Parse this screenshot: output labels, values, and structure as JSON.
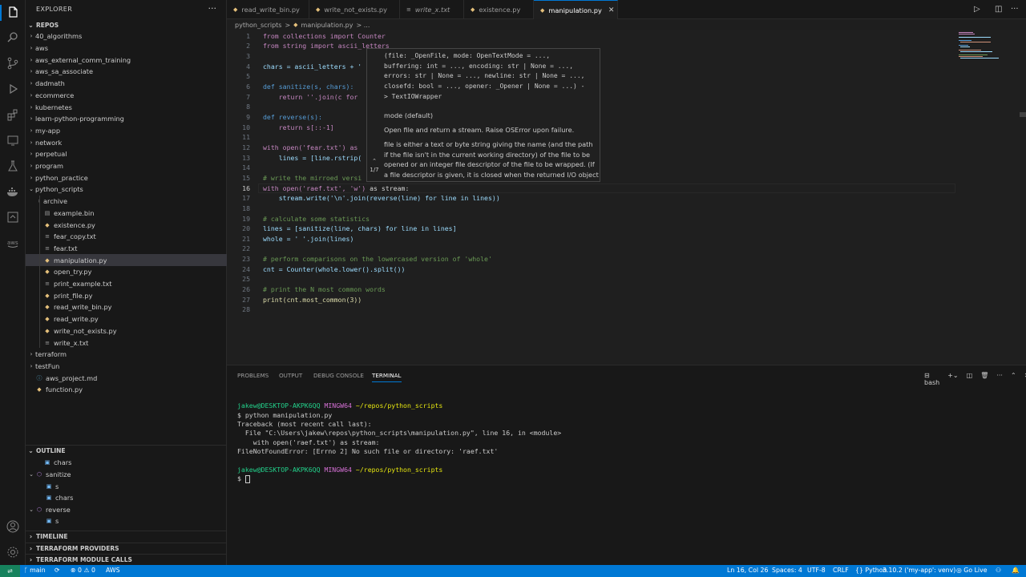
{
  "explorer": {
    "title": "EXPLORER",
    "more": "···",
    "repos_label": "REPOS",
    "folders": [
      "40_algorithms",
      "aws",
      "aws_external_comm_training",
      "aws_sa_associate",
      "dadmath",
      "ecommerce",
      "kubernetes",
      "learn-python-programming",
      "my-app",
      "network",
      "perpetual",
      "program",
      "python_practice",
      "python_scripts"
    ],
    "python_scripts_children": [
      "archive",
      "example.bin",
      "existence.py",
      "fear_copy.txt",
      "fear.txt",
      "manipulation.py",
      "open_try.py",
      "print_example.txt",
      "print_file.py",
      "read_write_bin.py",
      "read_write.py",
      "write_not_exists.py",
      "write_x.txt"
    ],
    "bottom_items": [
      "terraform",
      "testFun",
      "aws_project.md",
      "function.py"
    ]
  },
  "outline": {
    "label": "OUTLINE",
    "items": [
      "chars",
      "sanitize",
      "s",
      "chars",
      "reverse",
      "s"
    ]
  },
  "bottom_sections": [
    "TIMELINE",
    "TERRAFORM PROVIDERS",
    "TERRAFORM MODULE CALLS"
  ],
  "tabs": [
    "read_write_bin.py",
    "write_not_exists.py",
    "write_x.txt",
    "existence.py",
    "manipulation.py"
  ],
  "breadcrumb": {
    "folder": "python_scripts",
    "sep": ">",
    "file": "manipulation.py",
    "more": "> ..."
  },
  "code": {
    "l1": "from collections import Counter",
    "l2": "from string import ascii_letters",
    "l4": "chars = ascii_letters + '",
    "l6": "def sanitize(s, chars):",
    "l7": "    return ''.join(c for",
    "l9": "def reverse(s):",
    "l10": "    return s[::-1]",
    "l12": "with open('fear.txt') as",
    "l13": "    lines = [line.rstrip(",
    "l15": "# write the mirroed versi",
    "l16a": "with open('raef.txt', 'w')",
    "l16b": " as stream:",
    "l17": "    stream.write('\\n'.join(reverse(line) for line in lines))",
    "l19": "# calculate some statistics",
    "l20": "lines = [sanitize(line, chars) for line in lines]",
    "l21": "whole = ' '.join(lines)",
    "l23": "# perform comparisons on the lowercased version of 'whole'",
    "l24": "cnt = Counter(whole.lower().split())",
    "l26": "# print the N most common words",
    "l27": "print(cnt.most_common(3))"
  },
  "hover": {
    "sig1": "(file: _OpenFile, mode: OpenTextMode = ...,",
    "sig2": "buffering: int = ..., encoding: str | None = ...,",
    "sig3": "errors: str | None = ..., newline: str | None = ...,",
    "sig4": "closefd: bool = ..., opener: _Opener | None = ...) -",
    "sig5": "> TextIOWrapper",
    "param": "mode (default)",
    "summary": "Open file and return a stream. Raise OSError upon failure.",
    "detail": "file is either a text or byte string giving the name (and the path if the file isn't in the current working directory) of the file to be opened or an integer file descriptor of the file to be wrapped. (If a file descriptor is given, it is closed when the returned I/O object is closed, unless closefd is set to False.)",
    "pager": "1/7"
  },
  "panel": {
    "tabs": [
      "PROBLEMS",
      "OUTPUT",
      "DEBUG CONSOLE",
      "TERMINAL"
    ],
    "shell": "bash"
  },
  "terminal": {
    "user": "jakew@DESKTOP-AKPK6QQ",
    "env": "MINGW64",
    "path": "~/repos/python_scripts",
    "cmd": "$ python manipulation.py",
    "tb1": "Traceback (most recent call last):",
    "tb2": "  File \"C:\\Users\\jakew\\repos\\python_scripts\\manipulation.py\", line 16, in <module>",
    "tb3": "    with open('raef.txt') as stream:",
    "tb4": "FileNotFoundError: [Errno 2] No such file or directory: 'raef.txt'",
    "prompt": "$ "
  },
  "status": {
    "branch": "main",
    "errors": "0",
    "warnings": "0",
    "aws": "AWS",
    "position": "Ln 16, Col 26",
    "spaces": "Spaces: 4",
    "encoding": "UTF-8",
    "eol": "CRLF",
    "language": "Python",
    "interpreter": "3.10.2 ('my-app': venv)",
    "golive": "Go Live"
  },
  "colors": {
    "accent": "#0078d4",
    "status_bar": "#0078d4",
    "remote": "#16825d"
  }
}
